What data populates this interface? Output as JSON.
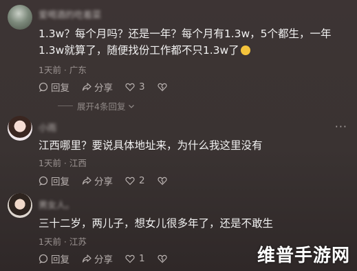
{
  "comments": [
    {
      "username": "爱喝酒的吃着菜",
      "text_line1": "1.3w？每个月吗？还是一年？每个月有1.3w，5个都生，一年",
      "text_line2": "1.3w就算了，随便找份工作都不只1.3w了",
      "meta": "1天前 · 广东",
      "reply_label": "回复",
      "share_label": "分享",
      "like_count": "3",
      "expand_label": "展开4条回复"
    },
    {
      "username": "小雨",
      "text_line1": "江西哪里？要说具体地址来，为什么我这里没有",
      "meta": "1天前 · 江西",
      "reply_label": "回复",
      "share_label": "分享",
      "like_count": "2",
      "more_label": "···"
    },
    {
      "username": "男女人。",
      "text_line1": "三十二岁，两儿子，想女儿很多年了，还是不敢生",
      "meta": "1天前 · 江苏",
      "reply_label": "回复",
      "share_label": "分享",
      "like_count": "1"
    }
  ],
  "watermark": "维普手游网",
  "icons": {
    "reply": "reply-icon",
    "share": "share-icon",
    "like": "heart-icon",
    "dislike": "dislike-icon",
    "expand": "chevron-down-icon",
    "emoji": "laughing-emoji-icon"
  },
  "colors": {
    "background": "#3a3332",
    "text": "#f1f1f1",
    "meta": "#9b9391",
    "watermark": "#ffffff"
  }
}
